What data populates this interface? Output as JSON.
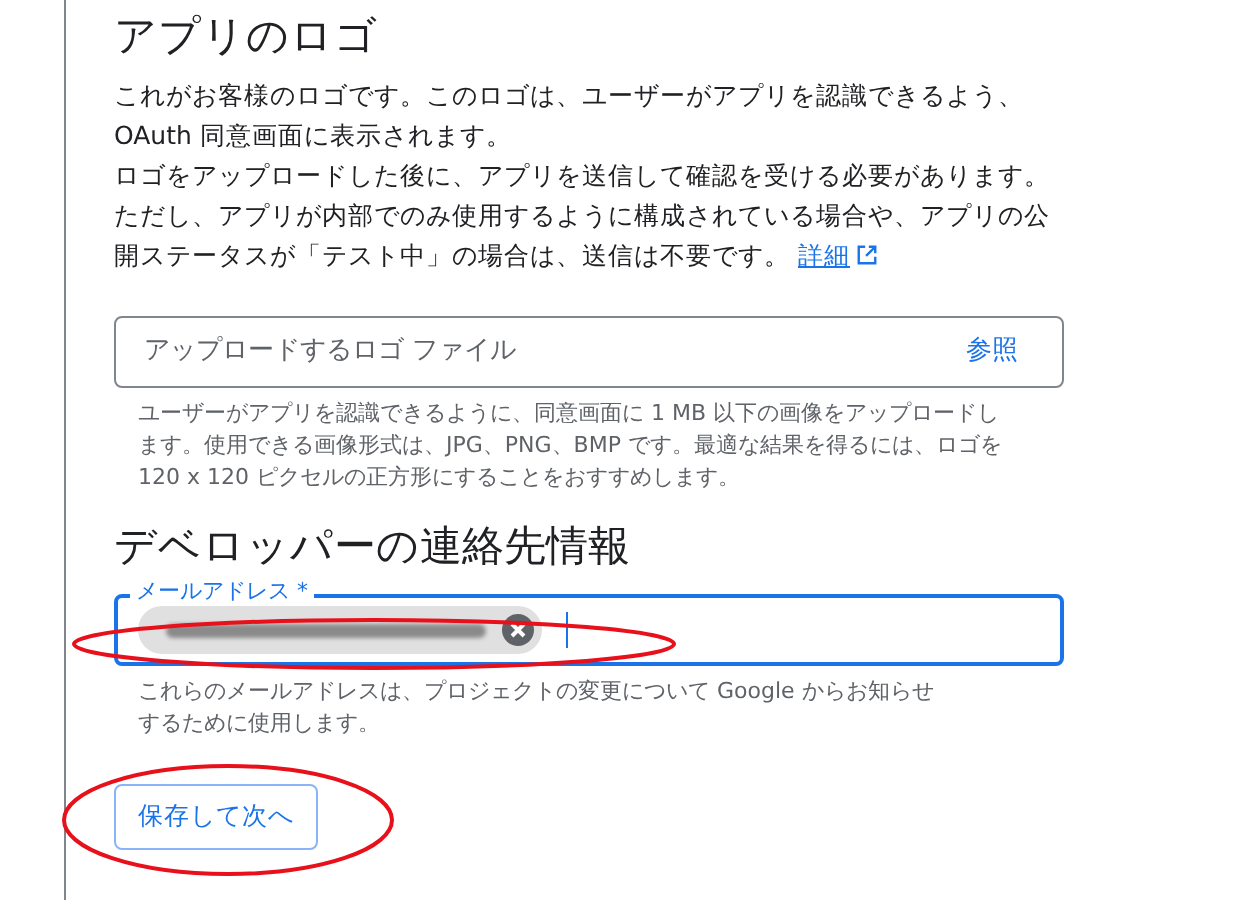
{
  "logo_section": {
    "heading": "アプリのロゴ",
    "paragraphs": [
      "これがお客様のロゴです。このロゴは、ユーザーがアプリを認識できるよう、OAuth 同意画面に表示されます。",
      "ロゴをアップロードした後に、アプリを送信して確認を受ける必要があります。ただし、アプリが内部でのみ使用するように構成されている場合や、アプリの公開ステータスが「テスト中」の場合は、送信は不要です。"
    ],
    "link": "詳細",
    "file_field": {
      "placeholder": "アップロードするロゴ ファイル",
      "browse": "参照"
    },
    "hint": "ユーザーがアプリを認識できるように、同意画面に 1 MB 以下の画像をアップロードします。使用できる画像形式は、JPG、PNG、BMP です。最適な結果を得るには、ロゴを 120 x 120 ピクセルの正方形にすることをおすすめします。"
  },
  "contact_section": {
    "heading": "デベロッパーの連絡先情報",
    "email_field": {
      "label": "メールアドレス *",
      "focused": true,
      "chips": [
        {
          "kind": "redacted"
        }
      ]
    },
    "hint": "これらのメールアドレスは、プロジェクトの変更について Google からお知らせするために使用します。"
  },
  "buttons": [
    "保存して次へ"
  ]
}
